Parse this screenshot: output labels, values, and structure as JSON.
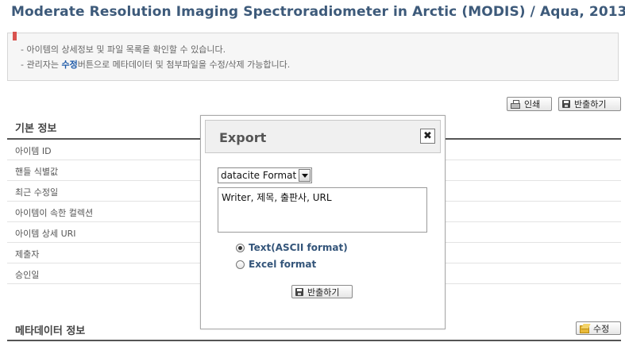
{
  "page": {
    "title": "Moderate Resolution Imaging Spectroradiometer in Arctic (MODIS) / Aqua, 2013"
  },
  "info": {
    "line1": "- 아이템의 상세정보 및 파일 목록을 확인할 수 있습니다.",
    "line2_prefix": "- 관리자는 ",
    "line2_highlight": "수정",
    "line2_suffix": "버튼으로 메타데이터 및 첨부파일을 수정/삭제 가능합니다."
  },
  "toolbar": {
    "print_label": "인쇄",
    "export_label": "반출하기"
  },
  "basic_info": {
    "title": "기본 정보",
    "fields": [
      "아이템 ID",
      "핸들 식별값",
      "최근 수정일",
      "아이템이 속한 컬렉션",
      "아이템 상세 URI",
      "제출자",
      "승인일"
    ]
  },
  "metadata_section": {
    "title": "메타데이터 정보",
    "edit_label": "수정"
  },
  "export_modal": {
    "title": "Export",
    "close_glyph": "✖",
    "format_selected": "datacite Format",
    "fields_text": "Writer, 제목, 출판사, URL",
    "options": [
      {
        "label": "Text(ASCII format)",
        "checked": true
      },
      {
        "label": "Excel format",
        "checked": false
      }
    ],
    "export_label": "반출하기"
  },
  "icons": {
    "print": "printer-icon",
    "export": "disk-icon",
    "edit": "folder-icon",
    "bookmark": "bookmark-icon",
    "dropdown": "chevron-down-icon"
  },
  "colors": {
    "title": "#3d5a7a",
    "highlight": "#1e5aa8",
    "radio_label": "#34557a",
    "bookmark": "#d9534f"
  }
}
